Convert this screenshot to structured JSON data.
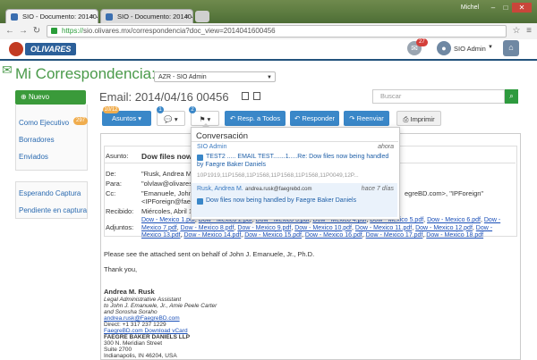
{
  "browser": {
    "tabs": [
      {
        "label": "SIO - Documento: 201404",
        "active": true
      },
      {
        "label": "SIO - Documento: 201404",
        "active": false
      }
    ],
    "user": "Michel",
    "url_scheme": "https://",
    "url_rest": "sio.olivares.mx/correspondencia?doc_view=2014041600456"
  },
  "header": {
    "logo": "OLIVARES",
    "notif_count": "27",
    "user": "SIO Admin"
  },
  "page": {
    "title": "Mi Correspondencia:",
    "select_value": "AZR - SIO Admin",
    "new_button": "Nuevo",
    "email_title": "Email: 2014/04/16 00456",
    "search_placeholder": "Buscar"
  },
  "sidebar": {
    "items": [
      "Como Ejecutivo",
      "Borradores",
      "Enviados"
    ],
    "ejecutivo_count": "297",
    "items2": [
      "Esperando Captura",
      "Pendiente en captura"
    ]
  },
  "toolbar": {
    "asuntos": "Asuntos",
    "asuntos_count": "10/12",
    "comments_count": "1",
    "flag_count": "2",
    "resp_todos": "Resp. a Todos",
    "responder": "Responder",
    "reenviar": "Reenviar",
    "imprimir": "Imprimir"
  },
  "message": {
    "labels": {
      "asunto": "Asunto:",
      "de": "De:",
      "para": "Para:",
      "cc": "Cc:",
      "recibido": "Recibido:",
      "adjuntos": "Adjuntos:"
    },
    "subject": "Dow files now b",
    "from": "\"Rusk, Andrea M.\" <",
    "to": "\"olvlaw@olivares.c",
    "cc1": "\"Emanuele, John J",
    "cc2": "<IPForeign@faegr",
    "cc_tail": "egreBD.com>, \"IPForeign\"",
    "received": "Miércoles, Abril 16,",
    "attachments": [
      [
        "Dow - Mexico 1.pdf",
        "Dow - Mexico 2.pdf",
        "Dow - Mexico 3.pdf",
        "Dow - Mexico 4.pdf",
        "Dow - Mexico 5.pdf",
        "Dow - Mexico 6.pdf",
        "Dow -"
      ],
      [
        "Mexico 7.pdf",
        "Dow - Mexico 8.pdf",
        "Dow - Mexico 9.pdf",
        "Dow - Mexico 10.pdf",
        "Dow - Mexico 11.pdf",
        "Dow - Mexico 12.pdf",
        "Dow -"
      ],
      [
        "Mexico 13.pdf",
        "Dow - Mexico 14.pdf",
        "Dow - Mexico 15.pdf",
        "Dow - Mexico 16.pdf",
        "Dow - Mexico 17.pdf",
        "Dow - Mexico 18.pdf"
      ]
    ],
    "body1": "Please see the attached sent on behalf of John J. Emanuele, Jr., Ph.D.",
    "body2": "Thank you,",
    "sig_name": "Andrea M. Rusk",
    "sig_lines": [
      "Legal Administrative Assistant",
      "to John J. Emanuele, Jr., Amie Peele Carter",
      "and Sorosha Soraho",
      "andrea.rusk@FaegreBD.com",
      "Direct: +1 317 237 1229",
      "FaegreBD.com   Download vCard",
      "FAEGRE BAKER DANIELS LLP",
      "300 N. Meridian Street",
      "Suite 2700",
      "Indianapolis, IN 46204, USA"
    ]
  },
  "conversation": {
    "title": "Conversación",
    "items": [
      {
        "name": "SIO Admin",
        "time": "ahora",
        "text": "TEST2 ..... EMAIL TEST.......1.....Re: Dow files now being handled by Faegre Baker Daniels",
        "meta": "10P1919,11P1568,11P1568,11P1568,11P1568,11P0049,12P..."
      },
      {
        "name": "Rusk, Andrea M.",
        "email": "andrea.rusk@faegrebd.com",
        "time": "hace 7 días",
        "text": "Dow files now being handled by Faegre Baker Daniels"
      }
    ]
  }
}
